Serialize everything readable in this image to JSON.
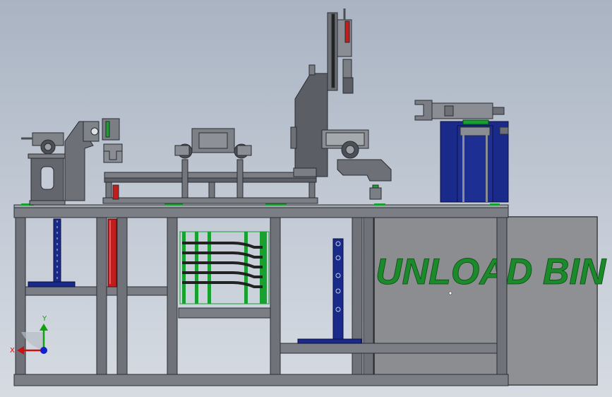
{
  "colors": {
    "frame": "#6e7278",
    "frame_dark": "#34383d",
    "frame_light": "#9aa0a6",
    "blue_part": "#1a2a8a",
    "red_part": "#c21c1c",
    "green_part": "#18a030",
    "black_part": "#222222",
    "bin": "#8a8c8f",
    "text_green": "#1a8a2a",
    "axis_x": "#cc1010",
    "axis_y": "#10a010",
    "axis_z": "#1020cc"
  },
  "bin": {
    "label": "UNLOAD BIN"
  },
  "triad": {
    "x_label": "X",
    "y_label": "Y"
  }
}
